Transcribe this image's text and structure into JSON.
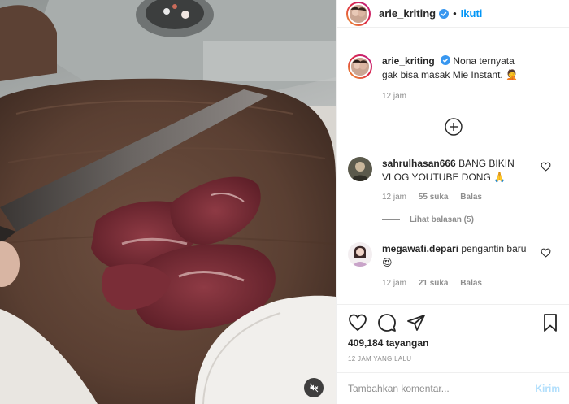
{
  "header": {
    "username": "arie_kriting",
    "separator": "•",
    "follow_label": "Ikuti"
  },
  "caption": {
    "username": "arie_kriting",
    "text": "Nona ternyata gak bisa masak Mie Instant. 🤦",
    "time": "12 jam"
  },
  "comments": [
    {
      "username": "sahrulhasan666",
      "text": "BANG BIKIN VLOG YOUTUBE DONG 🙏",
      "time": "12 jam",
      "likes": "55 suka",
      "reply_label": "Balas",
      "view_replies": "Lihat balasan (5)"
    },
    {
      "username": "megawati.depari",
      "text": "pengantin baru 😍",
      "time": "12 jam",
      "likes": "21 suka",
      "reply_label": "Balas"
    }
  ],
  "stats": {
    "views": "409,184 tayangan",
    "posted": "12 JAM YANG LALU"
  },
  "add_comment": {
    "placeholder": "Tambahkan komentar...",
    "post_label": "Kirim"
  },
  "colors": {
    "accent": "#0095f6",
    "post_disabled": "#b2dffc",
    "muted_text": "#8e8e8e",
    "verified": "#3897f0"
  },
  "icons": [
    "verified-badge-icon",
    "load-more-plus-icon",
    "heart-icon",
    "comment-icon",
    "share-icon",
    "bookmark-icon",
    "mute-icon"
  ]
}
